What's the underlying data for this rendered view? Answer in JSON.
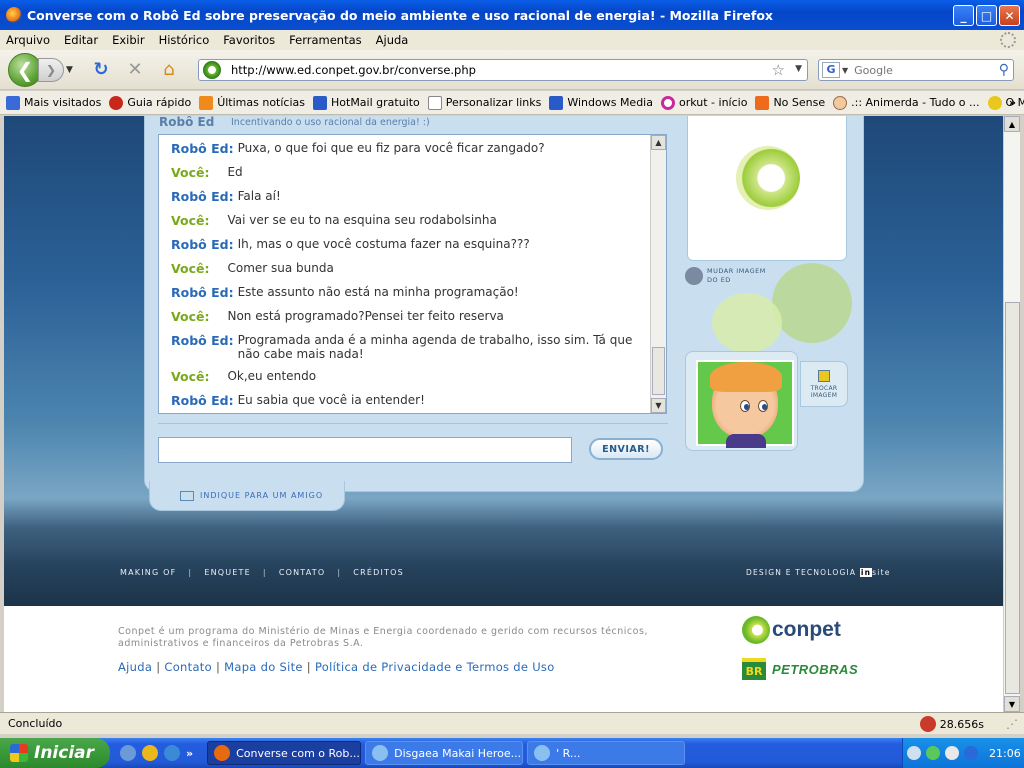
{
  "window": {
    "title": "Converse com o Robô Ed sobre preservação do meio ambiente e uso racional de energia! - Mozilla Firefox",
    "buttons": {
      "minimize": "_",
      "maximize": "□",
      "close": "✕"
    }
  },
  "menu": [
    "Arquivo",
    "Editar",
    "Exibir",
    "Histórico",
    "Favoritos",
    "Ferramentas",
    "Ajuda"
  ],
  "nav": {
    "url": "http://www.ed.conpet.gov.br/converse.php",
    "search_placeholder": "Google",
    "search_engine": "G"
  },
  "bookmarks": [
    {
      "label": "Mais visitados",
      "icon": "blue"
    },
    {
      "label": "Guia rápido",
      "icon": "red"
    },
    {
      "label": "Últimas notícias",
      "icon": "rss"
    },
    {
      "label": "HotMail gratuito",
      "icon": "msn"
    },
    {
      "label": "Personalizar links",
      "icon": "doc"
    },
    {
      "label": "Windows Media",
      "icon": "msn"
    },
    {
      "label": "orkut - início",
      "icon": "orkut"
    },
    {
      "label": "No Sense",
      "icon": "blogger"
    },
    {
      "label": ".:: Animerda - Tudo o ...",
      "icon": "face"
    },
    {
      "label": "O Menino Chorão",
      "icon": "yellow"
    }
  ],
  "bookmarks_more": "»",
  "panel": {
    "name": "Robô Ed",
    "tagline": "Incentivando o uso racional da energia! :)",
    "send_label": "ENVIAR!",
    "recommend_label": "INDIQUE PARA UM AMIGO",
    "change_image_label": "MUDAR IMAGEM DO ED",
    "swap_image_label": "TROCAR IMAGEM"
  },
  "chat": [
    {
      "speaker": "Robô Ed",
      "role": "ed",
      "text": "Puxa, o que foi que eu fiz para você ficar zangado?"
    },
    {
      "speaker": "Você",
      "role": "voce",
      "text": "Ed"
    },
    {
      "speaker": "Robô Ed",
      "role": "ed",
      "text": "Fala aí!"
    },
    {
      "speaker": "Você",
      "role": "voce",
      "text": "Vai ver se eu to na esquina seu rodabolsinha"
    },
    {
      "speaker": "Robô Ed",
      "role": "ed",
      "text": "Ih, mas o que você costuma fazer na esquina???"
    },
    {
      "speaker": "Você",
      "role": "voce",
      "text": "Comer sua bunda"
    },
    {
      "speaker": "Robô Ed",
      "role": "ed",
      "text": "Este assunto não está na minha programação!"
    },
    {
      "speaker": "Você",
      "role": "voce",
      "text": "Non está programado?Pensei ter feito reserva"
    },
    {
      "speaker": "Robô Ed",
      "role": "ed",
      "text": "Programada anda é a minha agenda de trabalho, isso sim. Tá que não cabe mais nada!"
    },
    {
      "speaker": "Você",
      "role": "voce",
      "text": "Ok,eu entendo"
    },
    {
      "speaker": "Robô Ed",
      "role": "ed",
      "text": "Eu sabia que você ia entender!"
    }
  ],
  "footer_nav": [
    "MAKING OF",
    "ENQUETE",
    "CONTATO",
    "CRÉDITOS"
  ],
  "footer_sep": "|",
  "design_credit": "DESIGN E TECNOLOGIA",
  "design_brand_a": "in",
  "design_brand_b": "site",
  "disclaimer": "Conpet é um programa do Ministério de Minas e Energia coordenado e gerido com recursos técnicos, administrativos e financeiros da Petrobras S.A.",
  "links": [
    "Ajuda",
    "Contato",
    "Mapa do Site",
    "Política de Privacidade e Termos de Uso"
  ],
  "logos": {
    "conpet": "conpet",
    "petrobras_badge": "BR",
    "petrobras": "PETROBRAS"
  },
  "status": {
    "text": "Concluído",
    "timer": "28.656s"
  },
  "taskbar": {
    "start": "Iniciar",
    "tasks": [
      {
        "label": "Converse com o Rob...",
        "active": true
      },
      {
        "label": "Disgaea Makai Heroe...",
        "active": false
      },
      {
        "label": "' R...",
        "active": false
      }
    ],
    "clock": "21:06"
  },
  "colors": {
    "ed": "#2a6ab8",
    "voce": "#7aa81c",
    "panel": "#c9dff0"
  }
}
